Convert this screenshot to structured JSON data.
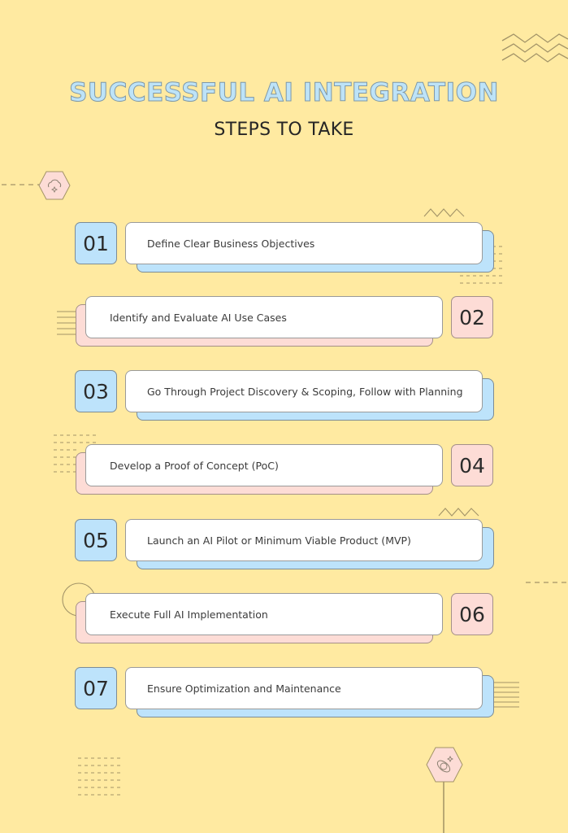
{
  "header": {
    "title": "SUCCESSFUL AI INTEGRATION",
    "subtitle": "STEPS TO TAKE"
  },
  "colors": {
    "background": "#ffeaa1",
    "accent_blue": "#bde3fb",
    "accent_pink": "#fddcd6",
    "card": "#ffffff",
    "line": "#9b8a5e"
  },
  "steps": [
    {
      "number": "01",
      "label": "Define Clear Business Objectives",
      "color": "blue",
      "side": "left"
    },
    {
      "number": "02",
      "label": "Identify and Evaluate AI Use Cases",
      "color": "pink",
      "side": "right"
    },
    {
      "number": "03",
      "label": "Go Through Project Discovery & Scoping, Follow with Planning",
      "color": "blue",
      "side": "left"
    },
    {
      "number": "04",
      "label": "Develop a Proof of Concept (PoC)",
      "color": "pink",
      "side": "right"
    },
    {
      "number": "05",
      "label": "Launch an AI Pilot or Minimum Viable Product (MVP)",
      "color": "blue",
      "side": "left"
    },
    {
      "number": "06",
      "label": "Execute Full AI Implementation",
      "color": "pink",
      "side": "right"
    },
    {
      "number": "07",
      "label": "Ensure Optimization and Maintenance",
      "color": "blue",
      "side": "left"
    }
  ],
  "icons": {
    "top_hexagon": "cloud-sparkle-icon",
    "bottom_hexagon": "planet-sparkle-icon"
  }
}
